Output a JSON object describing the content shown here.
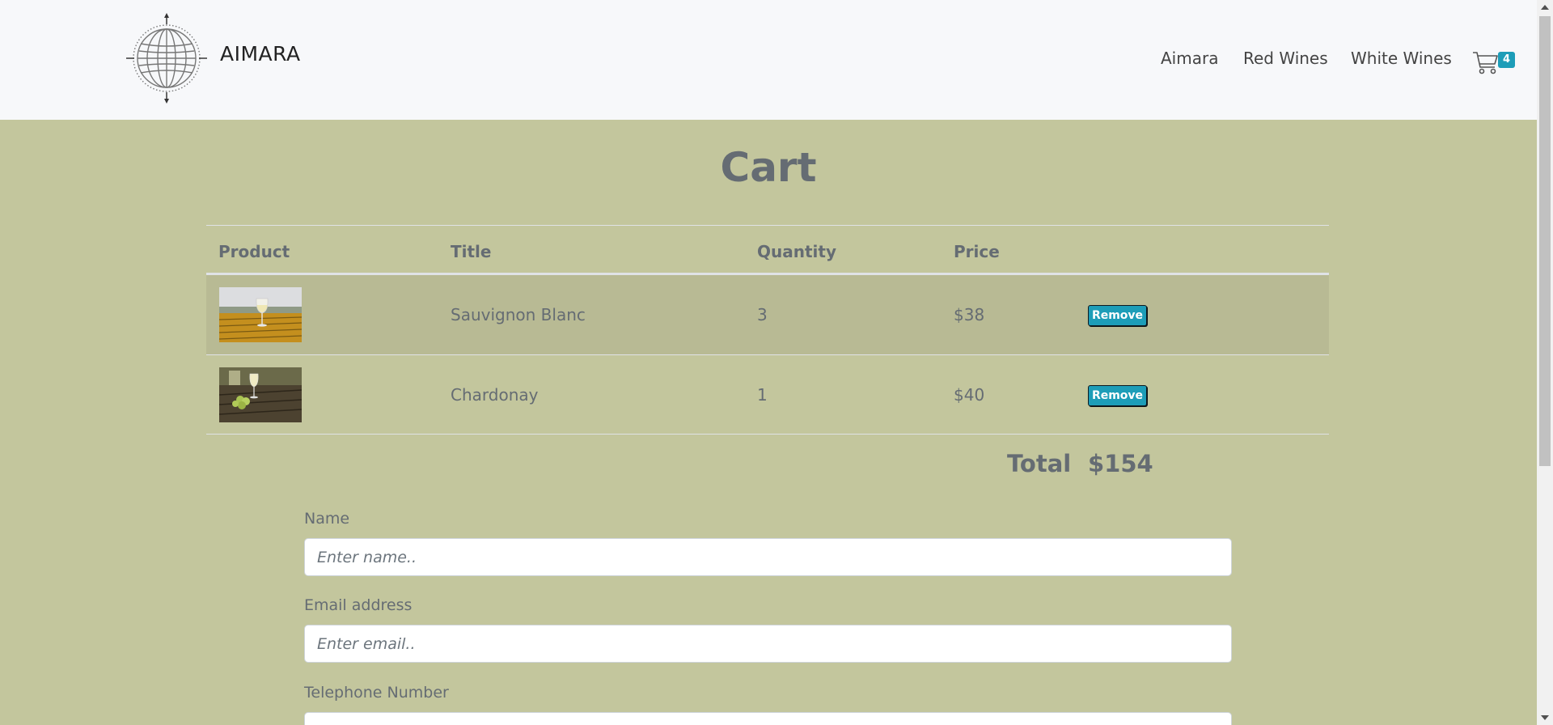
{
  "brand": {
    "name": "AIMARA"
  },
  "nav": {
    "links": [
      "Aimara",
      "Red Wines",
      "White Wines"
    ],
    "cart_count": "4"
  },
  "page": {
    "title": "Cart"
  },
  "table": {
    "headers": {
      "product": "Product",
      "title": "Title",
      "quantity": "Quantity",
      "price": "Price"
    },
    "rows": [
      {
        "title": "Sauvignon Blanc",
        "quantity": "3",
        "price": "$38",
        "action": "Remove"
      },
      {
        "title": "Chardonay",
        "quantity": "1",
        "price": "$40",
        "action": "Remove"
      }
    ]
  },
  "total": {
    "label": "Total",
    "value": "$154"
  },
  "form": {
    "name": {
      "label": "Name",
      "placeholder": "Enter name.."
    },
    "email": {
      "label": "Email address",
      "placeholder": "Enter email.."
    },
    "phone": {
      "label": "Telephone Number",
      "placeholder": ""
    }
  },
  "colors": {
    "accent": "#1d9db8",
    "background": "#c3c69d",
    "text": "#656c73"
  }
}
